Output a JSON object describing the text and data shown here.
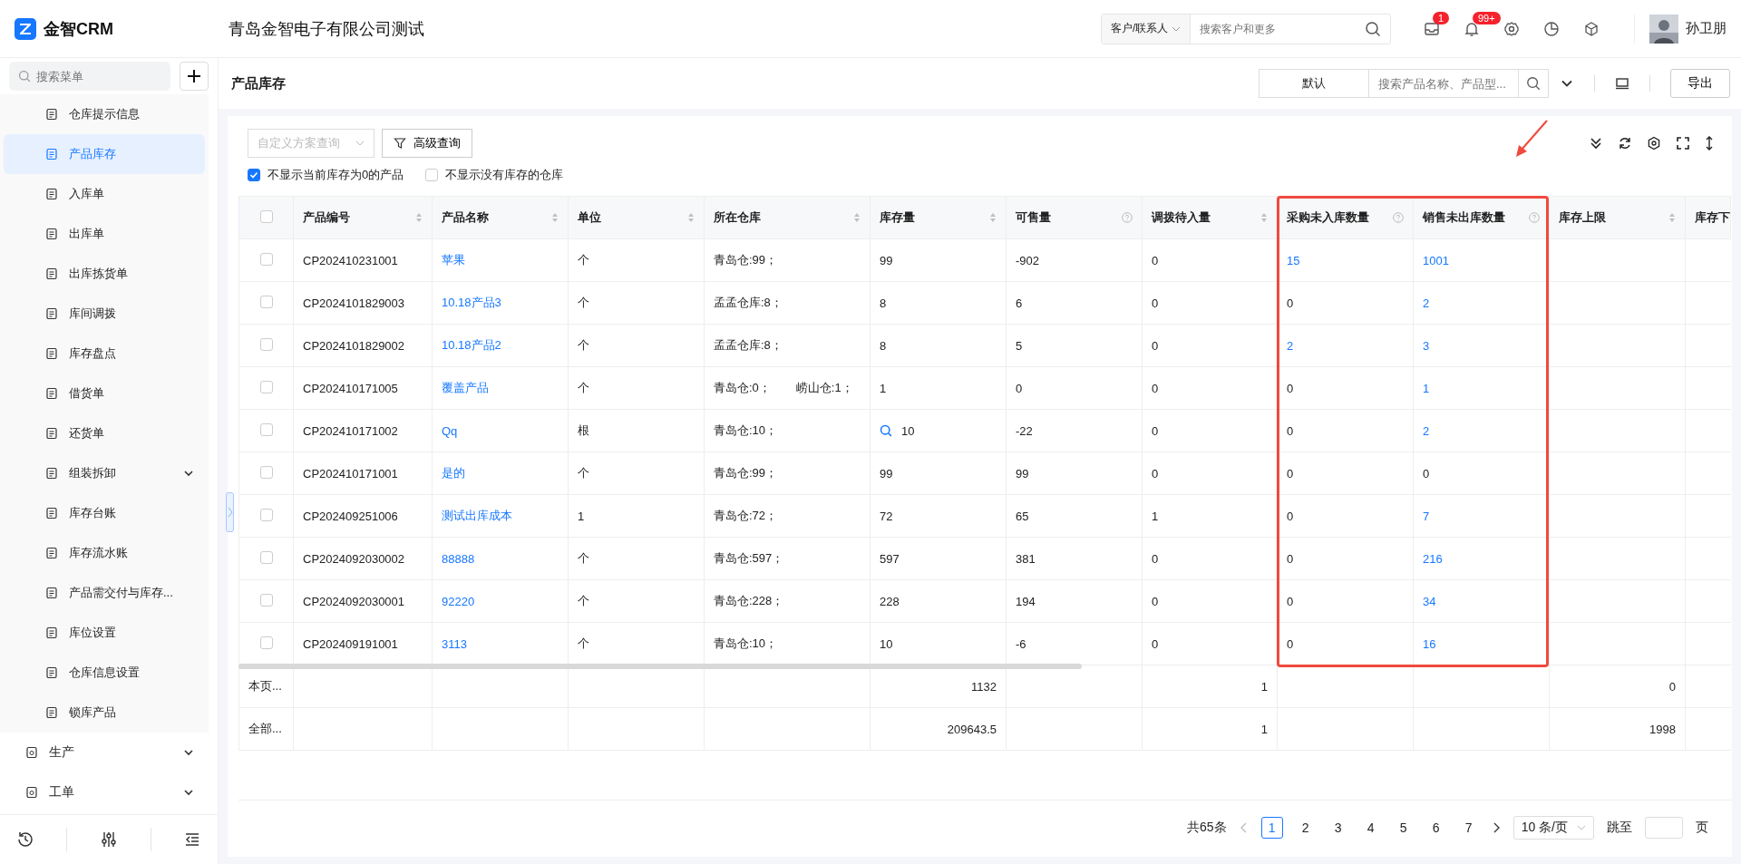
{
  "app": {
    "name": "金智CRM",
    "company": "青岛金智电子有限公司测试"
  },
  "global_search": {
    "scope": "客户/联系人",
    "placeholder": "搜索客户和更多"
  },
  "header_badges": [
    {
      "count": "1"
    },
    {
      "count": "99+"
    }
  ],
  "user": {
    "name": "孙卫朋"
  },
  "sidebar": {
    "search_placeholder": "搜索菜单",
    "items": [
      {
        "label": "仓库提示信息",
        "selected": false,
        "expandable": false
      },
      {
        "label": "产品库存",
        "selected": true,
        "expandable": false
      },
      {
        "label": "入库单",
        "selected": false,
        "expandable": false
      },
      {
        "label": "出库单",
        "selected": false,
        "expandable": false
      },
      {
        "label": "出库拣货单",
        "selected": false,
        "expandable": false
      },
      {
        "label": "库间调拨",
        "selected": false,
        "expandable": false
      },
      {
        "label": "库存盘点",
        "selected": false,
        "expandable": false
      },
      {
        "label": "借货单",
        "selected": false,
        "expandable": false
      },
      {
        "label": "还货单",
        "selected": false,
        "expandable": false
      },
      {
        "label": "组装拆卸",
        "selected": false,
        "expandable": true
      },
      {
        "label": "库存台账",
        "selected": false,
        "expandable": false
      },
      {
        "label": "库存流水账",
        "selected": false,
        "expandable": false
      },
      {
        "label": "产品需交付与库存...",
        "selected": false,
        "expandable": false
      },
      {
        "label": "库位设置",
        "selected": false,
        "expandable": false
      },
      {
        "label": "仓库信息设置",
        "selected": false,
        "expandable": false
      },
      {
        "label": "锁库产品",
        "selected": false,
        "expandable": false
      }
    ],
    "groups": [
      {
        "label": "生产"
      },
      {
        "label": "工单"
      }
    ]
  },
  "page": {
    "title": "产品库存",
    "view_select": "默认",
    "search_placeholder": "搜索产品名称、产品型...",
    "export_button": "导出"
  },
  "toolbar": {
    "scheme_select": "自定义方案查询",
    "advanced_button": "高级查询",
    "filters": [
      {
        "label": "不显示当前库存为0的产品",
        "checked": true
      },
      {
        "label": "不显示没有库存的仓库",
        "checked": false
      }
    ]
  },
  "table": {
    "select_all_checked": false,
    "columns": [
      {
        "label": "产品编号",
        "kind": "sort",
        "highlighted": false
      },
      {
        "label": "产品名称",
        "kind": "sort",
        "highlighted": false
      },
      {
        "label": "单位",
        "kind": "sort",
        "highlighted": false
      },
      {
        "label": "所在仓库",
        "kind": "sort",
        "highlighted": false
      },
      {
        "label": "库存量",
        "kind": "sort",
        "highlighted": false
      },
      {
        "label": "可售量",
        "kind": "help",
        "highlighted": false
      },
      {
        "label": "调拨待入量",
        "kind": "sort",
        "highlighted": false
      },
      {
        "label": "采购未入库数量",
        "kind": "help",
        "highlighted": true
      },
      {
        "label": "销售未出库数量",
        "kind": "help",
        "highlighted": true
      },
      {
        "label": "库存上限",
        "kind": "sort",
        "highlighted": false
      },
      {
        "label": "库存下",
        "kind": "plain",
        "highlighted": false
      }
    ],
    "rows": [
      {
        "checked": false,
        "code": "CP202410231001",
        "name": "苹果",
        "unit": "个",
        "warehouses": [
          "青岛仓:99；"
        ],
        "stock": "99",
        "stock_search": false,
        "available": "-902",
        "transfer_in": "0",
        "purchase_pending": {
          "value": "15",
          "link": true
        },
        "sales_pending": {
          "value": "1001",
          "link": true
        }
      },
      {
        "checked": false,
        "code": "CP2024101829003",
        "name": "10.18产品3",
        "unit": "个",
        "warehouses": [
          "孟孟仓库:8；"
        ],
        "stock": "8",
        "stock_search": false,
        "available": "6",
        "transfer_in": "0",
        "purchase_pending": {
          "value": "0",
          "link": false
        },
        "sales_pending": {
          "value": "2",
          "link": true
        }
      },
      {
        "checked": false,
        "code": "CP2024101829002",
        "name": "10.18产品2",
        "unit": "个",
        "warehouses": [
          "孟孟仓库:8；"
        ],
        "stock": "8",
        "stock_search": false,
        "available": "5",
        "transfer_in": "0",
        "purchase_pending": {
          "value": "2",
          "link": true
        },
        "sales_pending": {
          "value": "3",
          "link": true
        }
      },
      {
        "checked": false,
        "code": "CP202410171005",
        "name": "覆盖产品",
        "unit": "个",
        "warehouses": [
          "青岛仓:0；",
          "崂山仓:1；"
        ],
        "stock": "1",
        "stock_search": false,
        "available": "0",
        "transfer_in": "0",
        "purchase_pending": {
          "value": "0",
          "link": false
        },
        "sales_pending": {
          "value": "1",
          "link": true
        }
      },
      {
        "checked": false,
        "code": "CP202410171002",
        "name": "Qq",
        "unit": "根",
        "warehouses": [
          "青岛仓:10；"
        ],
        "stock": "10",
        "stock_search": true,
        "available": "-22",
        "transfer_in": "0",
        "purchase_pending": {
          "value": "0",
          "link": false
        },
        "sales_pending": {
          "value": "2",
          "link": true
        }
      },
      {
        "checked": false,
        "code": "CP202410171001",
        "name": "是的",
        "unit": "个",
        "warehouses": [
          "青岛仓:99；"
        ],
        "stock": "99",
        "stock_search": false,
        "available": "99",
        "transfer_in": "0",
        "purchase_pending": {
          "value": "0",
          "link": false
        },
        "sales_pending": {
          "value": "0",
          "link": false
        }
      },
      {
        "checked": false,
        "code": "CP202409251006",
        "name": "测试出库成本",
        "unit": "1",
        "warehouses": [
          "青岛仓:72；"
        ],
        "stock": "72",
        "stock_search": false,
        "available": "65",
        "transfer_in": "1",
        "purchase_pending": {
          "value": "0",
          "link": false
        },
        "sales_pending": {
          "value": "7",
          "link": true
        }
      },
      {
        "checked": false,
        "code": "CP2024092030002",
        "name": "88888",
        "unit": "个",
        "warehouses": [
          "青岛仓:597；"
        ],
        "stock": "597",
        "stock_search": false,
        "available": "381",
        "transfer_in": "0",
        "purchase_pending": {
          "value": "0",
          "link": false
        },
        "sales_pending": {
          "value": "216",
          "link": true
        }
      },
      {
        "checked": false,
        "code": "CP2024092030001",
        "name": "92220",
        "unit": "个",
        "warehouses": [
          "青岛仓:228；"
        ],
        "stock": "228",
        "stock_search": false,
        "available": "194",
        "transfer_in": "0",
        "purchase_pending": {
          "value": "0",
          "link": false
        },
        "sales_pending": {
          "value": "34",
          "link": true
        }
      },
      {
        "checked": false,
        "code": "CP202409191001",
        "name": "3113",
        "unit": "个",
        "warehouses": [
          "青岛仓:10；"
        ],
        "stock": "10",
        "stock_search": false,
        "available": "-6",
        "transfer_in": "0",
        "purchase_pending": {
          "value": "0",
          "link": false
        },
        "sales_pending": {
          "value": "16",
          "link": true
        }
      }
    ],
    "summaries": [
      {
        "label": "本页...",
        "stock": "1132",
        "transfer_in": "1",
        "upper_limit": "0"
      },
      {
        "label": "全部...",
        "stock": "209643.5",
        "transfer_in": "1",
        "upper_limit": "1998"
      }
    ]
  },
  "pagination": {
    "total": "共65条",
    "pages": [
      {
        "label": "1",
        "selected": true
      },
      {
        "label": "2",
        "selected": false
      },
      {
        "label": "3",
        "selected": false
      },
      {
        "label": "4",
        "selected": false
      },
      {
        "label": "5",
        "selected": false
      },
      {
        "label": "6",
        "selected": false
      },
      {
        "label": "7",
        "selected": false
      }
    ],
    "page_size": "10 条/页",
    "jump_label": "跳至",
    "page_unit": "页"
  }
}
